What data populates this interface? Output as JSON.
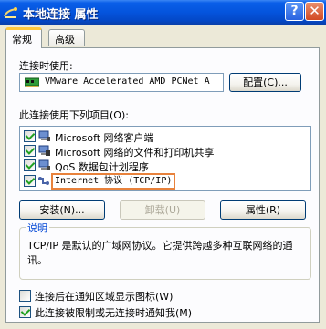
{
  "window": {
    "title": "本地连接 属性",
    "help_label": "?",
    "close_label": "✕"
  },
  "tabs": [
    {
      "label": "常规",
      "active": true
    },
    {
      "label": "高级",
      "active": false
    }
  ],
  "connect_using": {
    "label": "连接时使用:",
    "adapter": "VMware Accelerated AMD PCNet A",
    "configure_button": "配置(C)..."
  },
  "components": {
    "label": "此连接使用下列项目(O):",
    "items": [
      {
        "label": "Microsoft 网络客户端",
        "checked": true,
        "icon": "network-client-icon"
      },
      {
        "label": "Microsoft 网络的文件和打印机共享",
        "checked": true,
        "icon": "file-printer-sharing-icon"
      },
      {
        "label": "QoS 数据包计划程序",
        "checked": true,
        "icon": "qos-scheduler-icon"
      },
      {
        "label": "Internet 协议 (TCP/IP)",
        "checked": true,
        "icon": "protocol-icon",
        "selected": true
      }
    ]
  },
  "buttons": {
    "install": "安装(N)...",
    "uninstall": "卸载(U)",
    "properties": "属性(R)"
  },
  "description": {
    "title": "说明",
    "text": "TCP/IP 是默认的广域网协议。它提供跨越多种互联网络的通讯。"
  },
  "options": [
    {
      "label": "连接后在通知区域显示图标(W)",
      "checked": false
    },
    {
      "label": "此连接被限制或无连接时通知我(M)",
      "checked": true
    }
  ],
  "colors": {
    "titlebar": "#0454dd",
    "highlight_border": "#e8823c",
    "group_title": "#0046d5",
    "check": "#21a121"
  }
}
